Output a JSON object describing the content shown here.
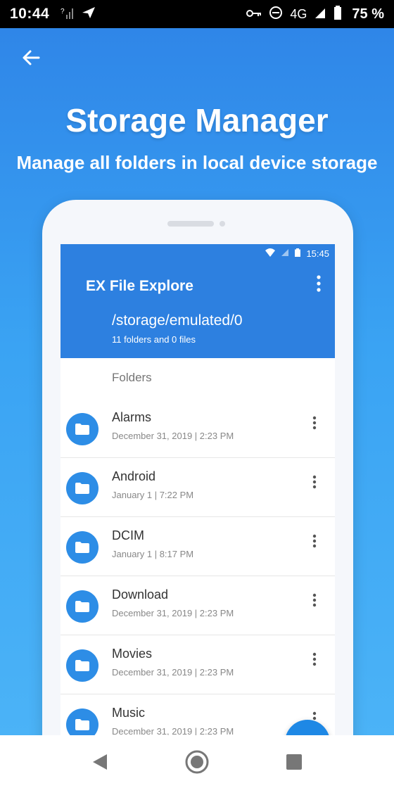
{
  "status_bar": {
    "time": "10:44",
    "network": "4G",
    "battery": "75 %"
  },
  "promo": {
    "title": "Storage Manager",
    "subtitle": "Manage all folders in local device storage"
  },
  "device_screen": {
    "status_time": "15:45",
    "app_title": "EX File Explore",
    "path": "/storage/emulated/0",
    "path_info": "11 folders and 0 files",
    "section_label": "Folders",
    "fab_label": "+",
    "folders": [
      {
        "name": "Alarms",
        "date": "December 31, 2019 | 2:23 PM"
      },
      {
        "name": "Android",
        "date": "January 1 | 7:22 PM"
      },
      {
        "name": "DCIM",
        "date": "January 1 | 8:17 PM"
      },
      {
        "name": "Download",
        "date": "December 31, 2019 | 2:23 PM"
      },
      {
        "name": "Movies",
        "date": "December 31, 2019 | 2:23 PM"
      },
      {
        "name": "Music",
        "date": "December 31, 2019 | 2:23 PM"
      }
    ]
  },
  "colors": {
    "accent": "#2d80e0",
    "background_top": "#2f86e8",
    "background_bottom": "#4bb3f7"
  }
}
